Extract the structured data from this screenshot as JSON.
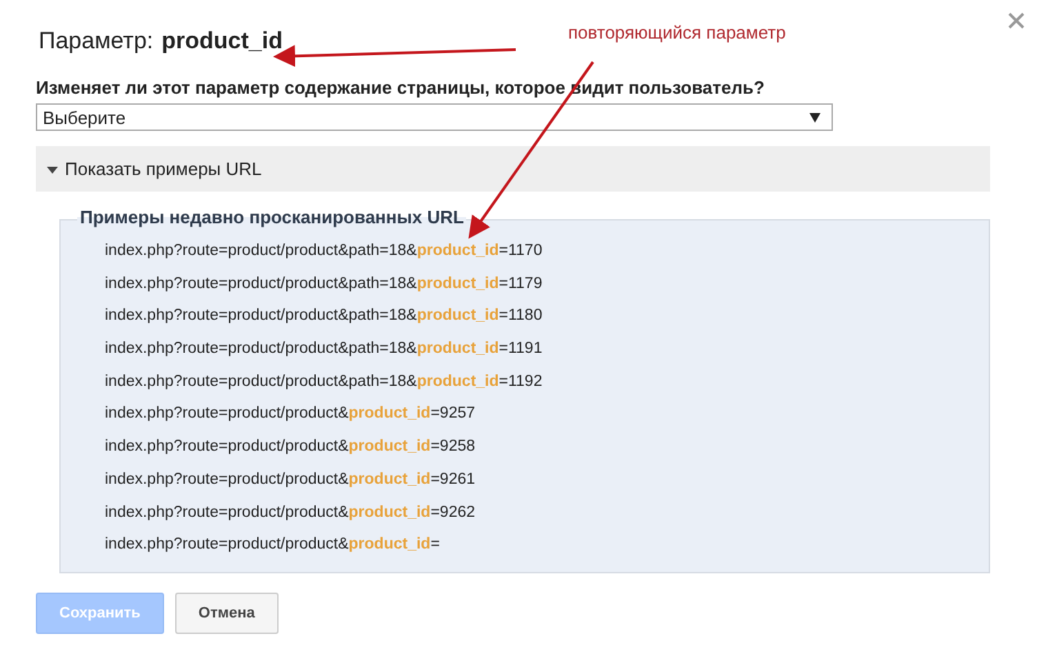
{
  "dialog": {
    "title_label": "Параметр:",
    "title_value": "product_id"
  },
  "question": {
    "label": "Изменяет ли этот параметр содержание страницы, которое видит пользователь?",
    "select_value": "Выберите"
  },
  "examples_section": {
    "toggle_label": "Показать примеры URL",
    "expanded": true,
    "legend": "Примеры недавно просканированных URL",
    "urls": [
      "index.php?route=product/product&path=18&**product_id**=1170",
      "index.php?route=product/product&path=18&**product_id**=1179",
      "index.php?route=product/product&path=18&**product_id**=1180",
      "index.php?route=product/product&path=18&**product_id**=1191",
      "index.php?route=product/product&path=18&**product_id**=1192",
      "index.php?route=product/product&**product_id**=9257",
      "index.php?route=product/product&**product_id**=9258",
      "index.php?route=product/product&**product_id**=9261",
      "index.php?route=product/product&**product_id**=9262",
      "index.php?route=product/product&**product_id**="
    ]
  },
  "buttons": [
    {
      "label": "Сохранить",
      "disabled": true
    },
    {
      "label": "Отмена",
      "disabled": false
    }
  ],
  "annotation": {
    "text": "повторяющийся параметр"
  }
}
